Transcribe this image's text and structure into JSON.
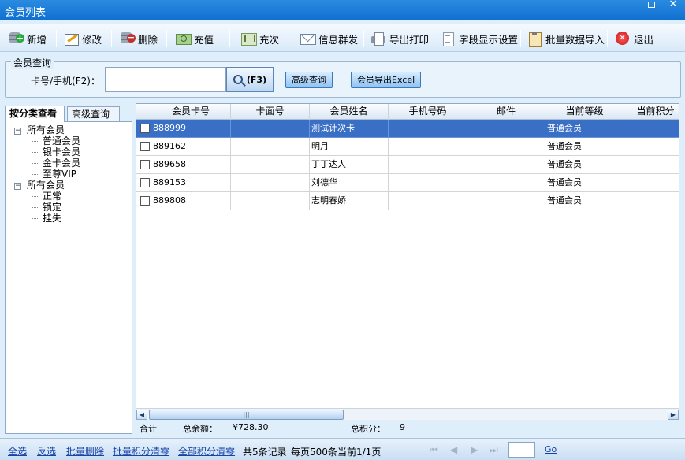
{
  "window": {
    "title": "会员列表"
  },
  "toolbar": {
    "add": "新增",
    "edit": "修改",
    "delete": "删除",
    "recharge": "充值",
    "charge_times": "充次",
    "message": "信息群发",
    "export_print": "导出打印",
    "field_settings": "字段显示设置",
    "batch_import": "批量数据导入",
    "exit": "退出"
  },
  "search": {
    "legend": "会员查询",
    "label": "卡号/手机(F2)：",
    "value": "",
    "search_button": "(F3)",
    "advanced_button": "高级查询",
    "export_button": "会员导出Excel"
  },
  "left": {
    "tabs": [
      "按分类查看",
      "高级查询"
    ],
    "tree": [
      {
        "label": "所有会员",
        "children": [
          "普通会员",
          "银卡会员",
          "金卡会员",
          "至尊VIP"
        ]
      },
      {
        "label": "所有会员",
        "children": [
          "正常",
          "锁定",
          "挂失"
        ]
      }
    ]
  },
  "grid": {
    "columns": [
      "会员卡号",
      "卡面号",
      "会员姓名",
      "手机号码",
      "邮件",
      "当前等级",
      "当前积分"
    ],
    "rows": [
      {
        "card": "888999",
        "face": "",
        "name": "测试计次卡",
        "phone": "",
        "email": "",
        "level": "普通会员",
        "points": ""
      },
      {
        "card": "889162",
        "face": "",
        "name": "明月",
        "phone": "",
        "email": "",
        "level": "普通会员",
        "points": ""
      },
      {
        "card": "889658",
        "face": "",
        "name": "丁丁达人",
        "phone": "",
        "email": "",
        "level": "普通会员",
        "points": ""
      },
      {
        "card": "889153",
        "face": "",
        "name": "刘德华",
        "phone": "",
        "email": "",
        "level": "普通会员",
        "points": ""
      },
      {
        "card": "889808",
        "face": "",
        "name": "志明春娇",
        "phone": "",
        "email": "",
        "level": "普通会员",
        "points": ""
      }
    ],
    "selected_index": 0
  },
  "summary": {
    "total_label": "合计",
    "balance_label": "总余额：",
    "balance_value": "¥728.30",
    "points_label": "总积分：",
    "points_value": "9"
  },
  "bottom": {
    "select_all": "全选",
    "invert": "反选",
    "batch_delete": "批量删除",
    "batch_points_clear": "批量积分清零",
    "all_points_clear": "全部积分清零",
    "record_count": "共5条记录",
    "page_size": "每页500条",
    "current_page": "当前1/1页",
    "page_value": "",
    "go": "Go"
  }
}
